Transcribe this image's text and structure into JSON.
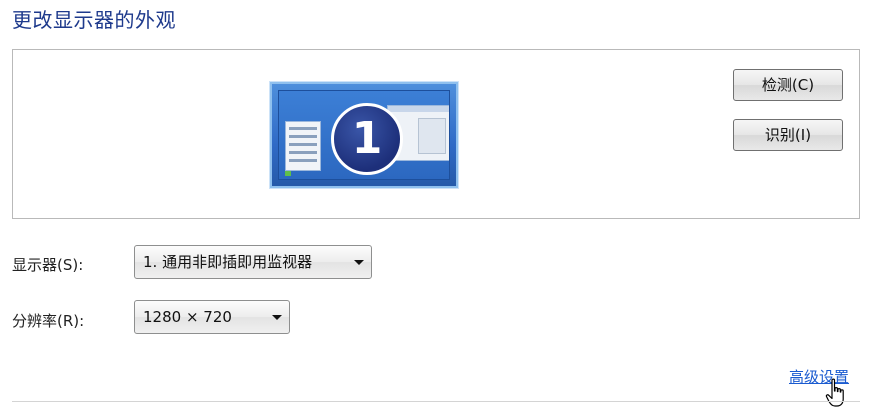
{
  "page": {
    "title": "更改显示器的外观"
  },
  "preview": {
    "monitor_number": "1",
    "detect_label": "检测(C)",
    "identify_label": "识别(I)"
  },
  "settings": {
    "display_label": "显示器(S):",
    "display_value": "1. 通用非即插即用监视器",
    "resolution_label": "分辨率(R):",
    "resolution_value": "1280 × 720"
  },
  "links": {
    "advanced": "高级设置"
  },
  "icons": {
    "dropdown": "chevron-down-icon",
    "cursor": "hand-pointer-icon"
  },
  "colors": {
    "title": "#1e3a8c",
    "link": "#1a5bd0",
    "monitor_blue": "#2f6ac6"
  }
}
